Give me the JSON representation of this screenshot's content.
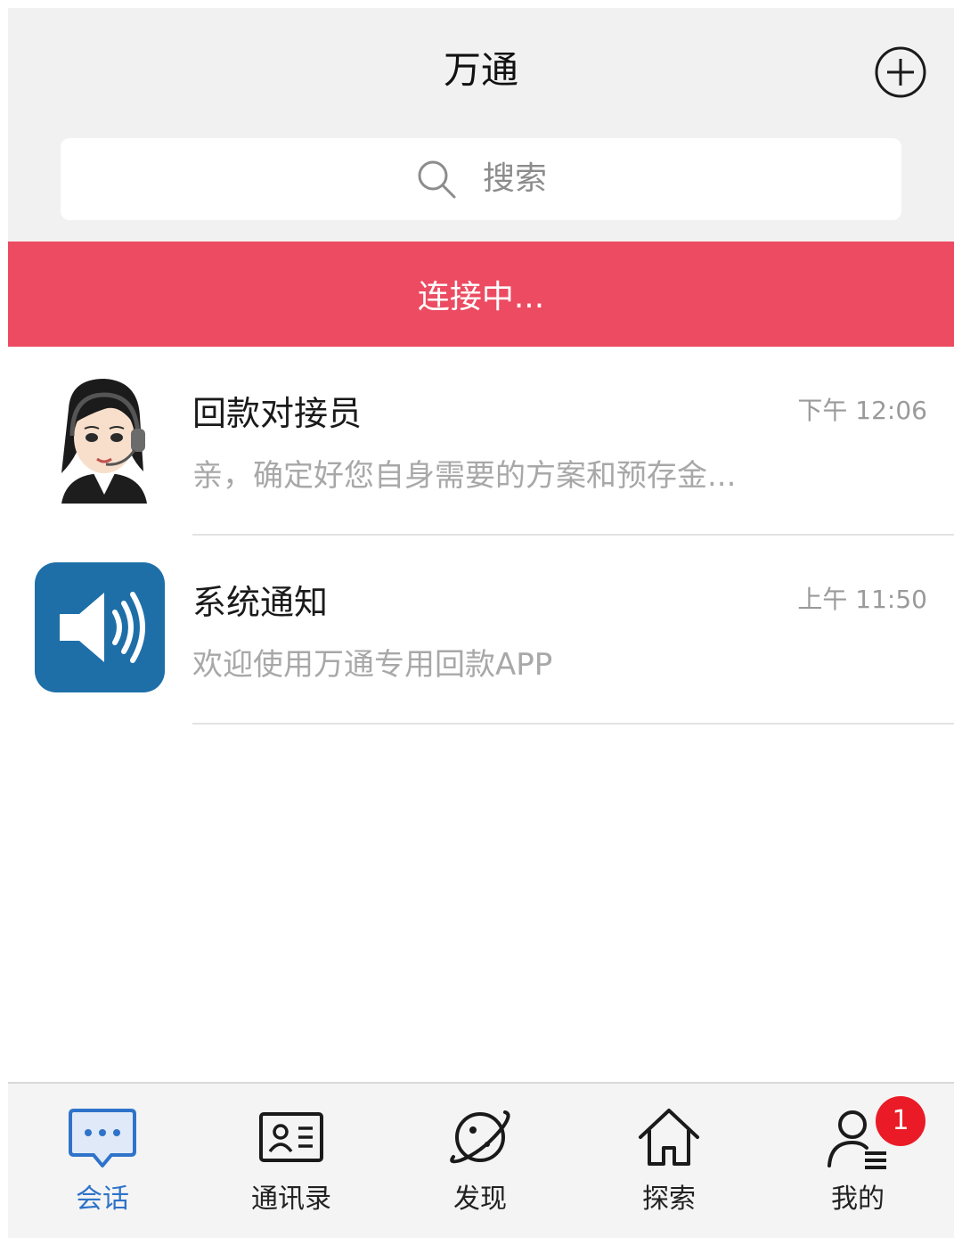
{
  "app": {
    "title": "万通"
  },
  "header": {
    "add_icon": "plus-circle-icon"
  },
  "search": {
    "label": "搜索",
    "icon": "search-icon"
  },
  "status_banner": {
    "text": "连接中...",
    "color": "#ec4b61"
  },
  "conversations": [
    {
      "name": "回款对接员",
      "time": "下午 12:06",
      "preview": "亲，确定好您自身需要的方案和预存金...",
      "avatar": "customer-service-avatar"
    },
    {
      "name": "系统通知",
      "time": "上午 11:50",
      "preview": "欢迎使用万通专用回款APP",
      "avatar": "speaker-icon",
      "avatar_color": "#1e6fa8"
    }
  ],
  "tabbar": {
    "active_color": "#2e73c9",
    "tabs": [
      {
        "label": "会话",
        "icon": "chat-bubble-icon",
        "active": true
      },
      {
        "label": "通讯录",
        "icon": "contact-card-icon",
        "active": false
      },
      {
        "label": "发现",
        "icon": "planet-icon",
        "active": false
      },
      {
        "label": "探索",
        "icon": "home-icon",
        "active": false
      },
      {
        "label": "我的",
        "icon": "user-icon",
        "active": false,
        "badge": "1"
      }
    ]
  }
}
